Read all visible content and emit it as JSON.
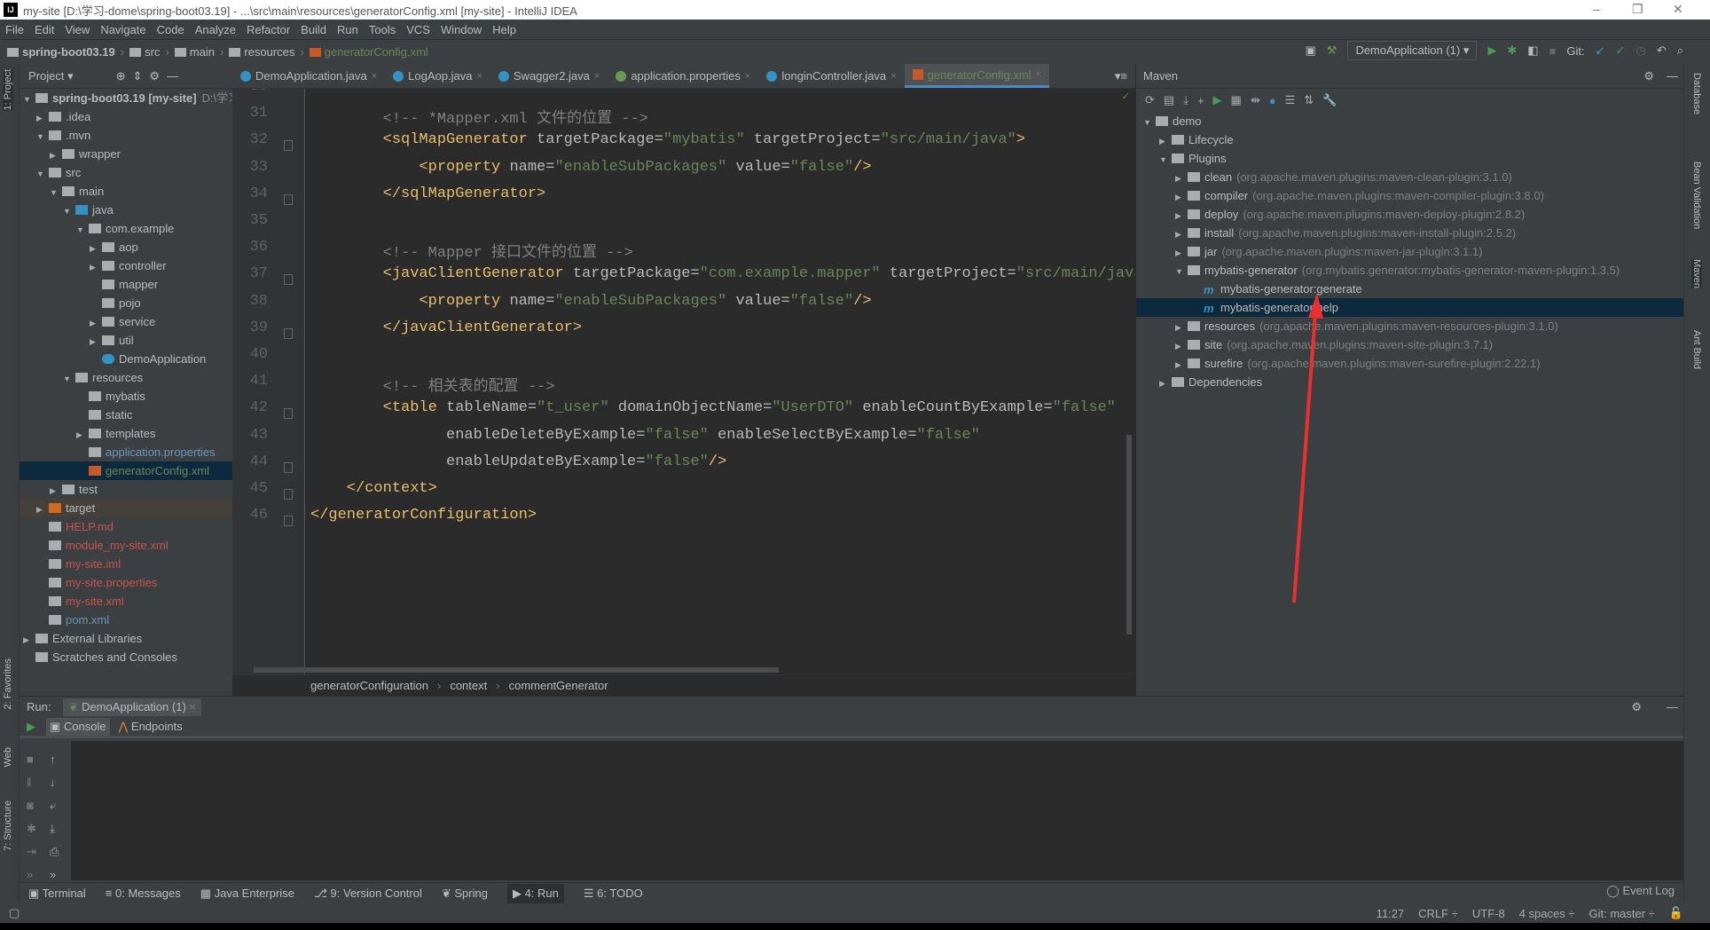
{
  "window": {
    "title": "my-site [D:\\学习-dome\\spring-boot03.19] - ...\\src\\main\\resources\\generatorConfig.xml [my-site] - IntelliJ IDEA",
    "app_icon": "IJ"
  },
  "menu": [
    "File",
    "Edit",
    "View",
    "Navigate",
    "Code",
    "Analyze",
    "Refactor",
    "Build",
    "Run",
    "Tools",
    "VCS",
    "Window",
    "Help"
  ],
  "navbar": [
    "spring-boot03.19",
    "src",
    "main",
    "resources",
    "generatorConfig.xml"
  ],
  "toolbar": {
    "run_config": "DemoApplication (1)",
    "git_label": "Git:"
  },
  "left_strip": [
    "1: Project",
    "2: Favorites",
    "Web",
    "7: Structure"
  ],
  "right_strip": [
    "Database",
    "Bean Validation",
    "Maven",
    "Ant Build"
  ],
  "project": {
    "title": "Project",
    "items": [
      {
        "label": "spring-boot03.19 [my-site]",
        "extra": "D:\\学习",
        "depth": 0,
        "arrow": "▼",
        "color": "#bbbbbb"
      },
      {
        "label": ".idea",
        "depth": 1,
        "arrow": "▶",
        "color": "#bbbbbb"
      },
      {
        "label": ".mvn",
        "depth": 1,
        "arrow": "▼",
        "color": "#bbbbbb"
      },
      {
        "label": "wrapper",
        "depth": 2,
        "arrow": "▶",
        "color": "#bbbbbb"
      },
      {
        "label": "src",
        "depth": 1,
        "arrow": "▼",
        "color": "#bbbbbb"
      },
      {
        "label": "main",
        "depth": 2,
        "arrow": "▼",
        "color": "#bbbbbb"
      },
      {
        "label": "java",
        "depth": 3,
        "arrow": "▼",
        "color": "#bbbbbb"
      },
      {
        "label": "com.example",
        "depth": 4,
        "arrow": "▼",
        "color": "#bbbbbb"
      },
      {
        "label": "aop",
        "depth": 5,
        "arrow": "▶",
        "color": "#bbbbbb"
      },
      {
        "label": "controller",
        "depth": 5,
        "arrow": "▶",
        "color": "#bbbbbb"
      },
      {
        "label": "mapper",
        "depth": 5,
        "arrow": "",
        "color": "#bbbbbb"
      },
      {
        "label": "pojo",
        "depth": 5,
        "arrow": "",
        "color": "#bbbbbb"
      },
      {
        "label": "service",
        "depth": 5,
        "arrow": "▶",
        "color": "#bbbbbb"
      },
      {
        "label": "util",
        "depth": 5,
        "arrow": "▶",
        "color": "#bbbbbb"
      },
      {
        "label": "DemoApplication",
        "depth": 5,
        "arrow": "",
        "color": "#bbbbbb"
      },
      {
        "label": "resources",
        "depth": 3,
        "arrow": "▼",
        "color": "#bbbbbb"
      },
      {
        "label": "mybatis",
        "depth": 4,
        "arrow": "",
        "color": "#bbbbbb"
      },
      {
        "label": "static",
        "depth": 4,
        "arrow": "",
        "color": "#bbbbbb"
      },
      {
        "label": "templates",
        "depth": 4,
        "arrow": "▶",
        "color": "#bbbbbb"
      },
      {
        "label": "application.properties",
        "depth": 4,
        "arrow": "",
        "color": "#6897bb"
      },
      {
        "label": "generatorConfig.xml",
        "depth": 4,
        "arrow": "",
        "color": "#6a8759",
        "selected": true
      },
      {
        "label": "test",
        "depth": 2,
        "arrow": "▶",
        "color": "#bbbbbb"
      },
      {
        "label": "target",
        "depth": 1,
        "arrow": "▶",
        "color": "#bbbbbb",
        "excluded": true
      },
      {
        "label": "HELP.md",
        "depth": 1,
        "arrow": "",
        "color": "#c75450"
      },
      {
        "label": "module_my-site.xml",
        "depth": 1,
        "arrow": "",
        "color": "#c75450"
      },
      {
        "label": "my-site.iml",
        "depth": 1,
        "arrow": "",
        "color": "#c75450"
      },
      {
        "label": "my-site.properties",
        "depth": 1,
        "arrow": "",
        "color": "#c75450"
      },
      {
        "label": "my-site.xml",
        "depth": 1,
        "arrow": "",
        "color": "#c75450"
      },
      {
        "label": "pom.xml",
        "depth": 1,
        "arrow": "",
        "color": "#6897bb"
      },
      {
        "label": "External Libraries",
        "depth": 0,
        "arrow": "▶",
        "color": "#bbbbbb"
      },
      {
        "label": "Scratches and Consoles",
        "depth": 0,
        "arrow": "",
        "color": "#bbbbbb"
      }
    ]
  },
  "tabs": [
    {
      "label": "DemoApplication.java"
    },
    {
      "label": "LogAop.java"
    },
    {
      "label": "Swagger2.java"
    },
    {
      "label": "application.properties"
    },
    {
      "label": "longinController.java"
    },
    {
      "label": "generatorConfig.xml",
      "active": true
    }
  ],
  "editor": {
    "first_line": 30,
    "lines": [
      [],
      [
        [
          "com",
          "        <!-- *Mapper.xml 文件的位置 -->"
        ]
      ],
      [
        [
          "tag",
          "        <sqlMapGenerator"
        ],
        [
          "attr",
          " targetPackage="
        ],
        [
          "val",
          "\"mybatis\""
        ],
        [
          "attr",
          " targetProject="
        ],
        [
          "val",
          "\"src/main/java\""
        ],
        [
          "tag",
          ">"
        ]
      ],
      [
        [
          "tag",
          "            <property"
        ],
        [
          "attr",
          " name="
        ],
        [
          "val",
          "\"enableSubPackages\""
        ],
        [
          "attr",
          " value="
        ],
        [
          "val",
          "\"false\""
        ],
        [
          "tag",
          "/>"
        ]
      ],
      [
        [
          "tag",
          "        </sqlMapGenerator>"
        ]
      ],
      [],
      [
        [
          "com",
          "        <!-- Mapper 接口文件的位置 -->"
        ]
      ],
      [
        [
          "tag",
          "        <javaClientGenerator"
        ],
        [
          "attr",
          " targetPackage="
        ],
        [
          "val",
          "\"com.example.mapper\""
        ],
        [
          "attr",
          " targetProject="
        ],
        [
          "val",
          "\"src/main/java\""
        ]
      ],
      [
        [
          "tag",
          "            <property"
        ],
        [
          "attr",
          " name="
        ],
        [
          "val",
          "\"enableSubPackages\""
        ],
        [
          "attr",
          " value="
        ],
        [
          "val",
          "\"false\""
        ],
        [
          "tag",
          "/>"
        ]
      ],
      [
        [
          "tag",
          "        </javaClientGenerator>"
        ]
      ],
      [],
      [
        [
          "com",
          "        <!-- 相关表的配置 -->"
        ]
      ],
      [
        [
          "tag",
          "        <table"
        ],
        [
          "attr",
          " tableName="
        ],
        [
          "val",
          "\"t_user\""
        ],
        [
          "attr",
          " domainObjectName="
        ],
        [
          "val",
          "\"UserDTO\""
        ],
        [
          "attr",
          " enableCountByExample="
        ],
        [
          "val",
          "\"false\""
        ]
      ],
      [
        [
          "attr",
          "               enableDeleteByExample="
        ],
        [
          "val",
          "\"false\""
        ],
        [
          "attr",
          " enableSelectByExample="
        ],
        [
          "val",
          "\"false\""
        ]
      ],
      [
        [
          "attr",
          "               enableUpdateByExample="
        ],
        [
          "val",
          "\"false\""
        ],
        [
          "tag",
          "/>"
        ]
      ],
      [
        [
          "tag",
          "    </context>"
        ]
      ],
      [
        [
          "tag",
          "</generatorConfiguration>"
        ]
      ]
    ]
  },
  "breadcrumb": [
    "generatorConfiguration",
    "context",
    "commentGenerator"
  ],
  "maven": {
    "title": "Maven",
    "items": [
      {
        "label": "demo",
        "depth": 0,
        "arrow": "▼"
      },
      {
        "label": "Lifecycle",
        "depth": 1,
        "arrow": "▶"
      },
      {
        "label": "Plugins",
        "depth": 1,
        "arrow": "▼"
      },
      {
        "label": "clean",
        "detail": "(org.apache.maven.plugins:maven-clean-plugin:3.1.0)",
        "depth": 2,
        "arrow": "▶"
      },
      {
        "label": "compiler",
        "detail": "(org.apache.maven.plugins:maven-compiler-plugin:3.8.0)",
        "depth": 2,
        "arrow": "▶"
      },
      {
        "label": "deploy",
        "detail": "(org.apache.maven.plugins:maven-deploy-plugin:2.8.2)",
        "depth": 2,
        "arrow": "▶"
      },
      {
        "label": "install",
        "detail": "(org.apache.maven.plugins:maven-install-plugin:2.5.2)",
        "depth": 2,
        "arrow": "▶"
      },
      {
        "label": "jar",
        "detail": "(org.apache.maven.plugins:maven-jar-plugin:3.1.1)",
        "depth": 2,
        "arrow": "▶"
      },
      {
        "label": "mybatis-generator",
        "detail": "(org.mybatis.generator:mybatis-generator-maven-plugin:1.3.5)",
        "depth": 2,
        "arrow": "▼"
      },
      {
        "label": "mybatis-generator:generate",
        "depth": 3,
        "arrow": "",
        "goal": true
      },
      {
        "label": "mybatis-generator:help",
        "depth": 3,
        "arrow": "",
        "goal": true,
        "selected": true
      },
      {
        "label": "resources",
        "detail": "(org.apache.maven.plugins:maven-resources-plugin:3.1.0)",
        "depth": 2,
        "arrow": "▶"
      },
      {
        "label": "site",
        "detail": "(org.apache.maven.plugins:maven-site-plugin:3.7.1)",
        "depth": 2,
        "arrow": "▶"
      },
      {
        "label": "surefire",
        "detail": "(org.apache.maven.plugins:maven-surefire-plugin:2.22.1)",
        "depth": 2,
        "arrow": "▶"
      },
      {
        "label": "Dependencies",
        "depth": 1,
        "arrow": "▶"
      }
    ]
  },
  "run": {
    "label": "Run:",
    "tab": "DemoApplication (1)",
    "console_tab": "Console",
    "endpoints_tab": "Endpoints"
  },
  "bottom_tabs": [
    "Terminal",
    "0: Messages",
    "Java Enterprise",
    "9: Version Control",
    "Spring",
    "4: Run",
    "6: TODO"
  ],
  "status": {
    "event_log": "Event Log",
    "position": "11:27",
    "line_sep": "CRLF ÷",
    "encoding": "UTF-8",
    "indent": "4 spaces ÷",
    "git": "Git: master ÷"
  },
  "colors": {
    "annotation_arrow": "#e8312f",
    "selection": "#0d293e",
    "accent": "#4a88c7"
  }
}
